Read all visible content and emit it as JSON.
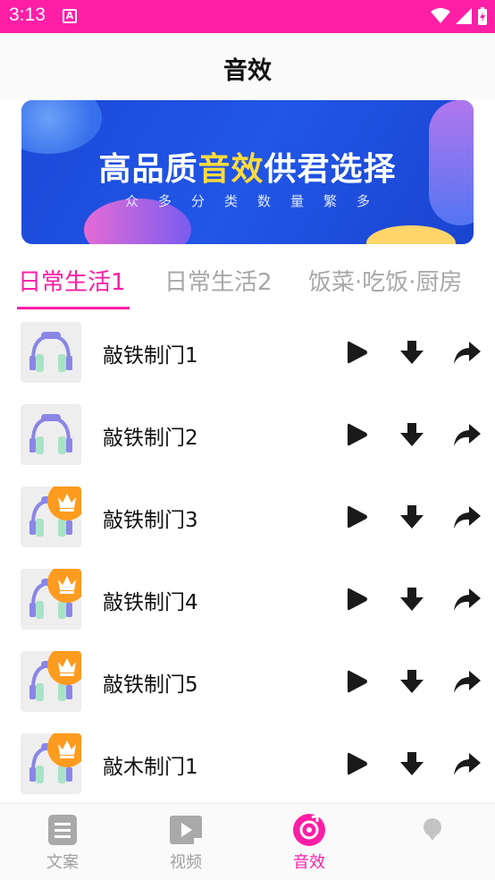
{
  "status_bar": {
    "time": "3:13",
    "notification_icon": "A"
  },
  "header": {
    "title": "音效"
  },
  "banner": {
    "title_before": "高品质",
    "title_highlight": "音效",
    "title_after": "供君选择",
    "subtitle": "众多分类数量繁多"
  },
  "tabs": [
    {
      "label": "日常生活1",
      "active": true
    },
    {
      "label": "日常生活2",
      "active": false
    },
    {
      "label": "饭菜·吃饭·厨房",
      "active": false
    }
  ],
  "sounds": [
    {
      "title": "敲铁制门1",
      "premium": false
    },
    {
      "title": "敲铁制门2",
      "premium": false
    },
    {
      "title": "敲铁制门3",
      "premium": true
    },
    {
      "title": "敲铁制门4",
      "premium": true
    },
    {
      "title": "敲铁制门5",
      "premium": true
    },
    {
      "title": "敲木制门1",
      "premium": true
    }
  ],
  "bottom_nav": [
    {
      "label": "文案",
      "icon": "document-icon",
      "active": false
    },
    {
      "label": "视频",
      "icon": "video-icon",
      "active": false
    },
    {
      "label": "音效",
      "icon": "music-disc-icon",
      "active": true
    },
    {
      "label": "",
      "icon": "profile-icon",
      "active": false
    }
  ],
  "colors": {
    "accent": "#ff1ea6",
    "banner_blue": "#2156e6",
    "crown_orange": "#ff9b1f"
  }
}
